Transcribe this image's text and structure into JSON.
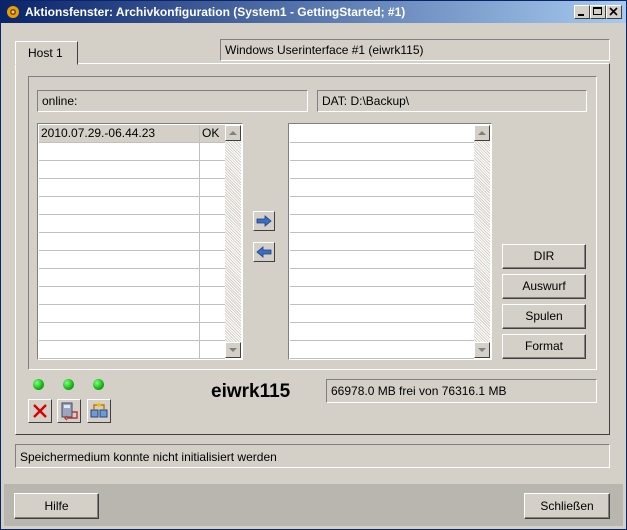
{
  "window": {
    "title": "Aktionsfenster: Archivkonfiguration (System1 - GettingStarted; #1)"
  },
  "tab": {
    "label": "Host 1"
  },
  "ui_label": "Windows Userinterface #1 (eiwrk115)",
  "status_online": "online:",
  "dat_path": "DAT: D:\\Backup\\",
  "left_list": {
    "rows": [
      {
        "name": "2010.07.29.-06.44.23",
        "status": "OK"
      }
    ],
    "empty_rows": 12
  },
  "right_list": {
    "empty_rows": 13
  },
  "buttons": {
    "dir": "DIR",
    "auswurf": "Auswurf",
    "spulen": "Spulen",
    "format": "Format",
    "hilfe": "Hilfe",
    "schliessen": "Schließen"
  },
  "hostname": "eiwrk115",
  "disk_info": "66978.0 MB frei von 76316.1 MB",
  "status_message": "Speichermedium konnte nicht initialisiert werden",
  "icons": {
    "leds": [
      "led-green-icon",
      "led-green-icon",
      "led-green-icon"
    ],
    "actions": [
      "delete-icon",
      "archive-icon",
      "network-icon"
    ]
  },
  "colors": {
    "titlebar_start": "#0a246a",
    "titlebar_end": "#a6caf0",
    "led": "#12b312",
    "face": "#d4d0c8"
  }
}
